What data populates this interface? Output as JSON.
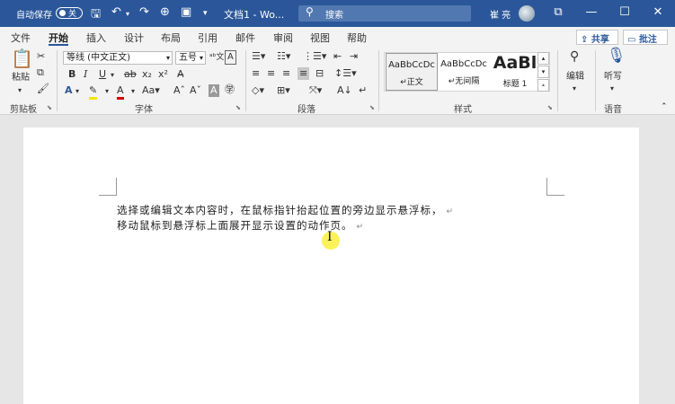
{
  "titlebar": {
    "autosave_label": "自动保存",
    "autosave_state": "关",
    "doc_title": "文档1 - Wo...",
    "search_placeholder": "搜索",
    "user_name": "崔 亮",
    "icons": [
      "save-icon",
      "undo-icon",
      "redo-icon",
      "touch-mode-icon",
      "print-preview-icon",
      "customize-qat-icon",
      "ribbon-display-icon",
      "minimize-icon",
      "maximize-icon",
      "close-icon"
    ]
  },
  "tabs": {
    "items": [
      "文件",
      "开始",
      "插入",
      "设计",
      "布局",
      "引用",
      "邮件",
      "审阅",
      "视图",
      "帮助"
    ],
    "active": "开始",
    "share": "共享",
    "comments": "批注"
  },
  "ribbon": {
    "clipboard": {
      "label": "剪贴板",
      "paste": "粘贴"
    },
    "font": {
      "label": "字体",
      "font_name": "等线 (中文正文)",
      "font_size": "五号"
    },
    "paragraph": {
      "label": "段落"
    },
    "styles": {
      "label": "样式",
      "items": [
        {
          "sample": "AaBbCcDc",
          "name": "↵正文"
        },
        {
          "sample": "AaBbCcDc",
          "name": "↵无间隔"
        },
        {
          "sample": "AaBl",
          "name": "标题 1"
        }
      ]
    },
    "editing": {
      "label": "编辑"
    },
    "voice": {
      "label": "语音",
      "dictate": "听写"
    }
  },
  "document": {
    "lines": [
      "选择或编辑文本内容时，在鼠标指针抬起位置的旁边显示悬浮标，",
      "移动鼠标到悬浮标上面展开显示设置的动作页。"
    ],
    "return_mark": "↵"
  },
  "colors": {
    "titlebar": "#2b579a",
    "ribbon": "#f3f3f3",
    "highlight": "#faf03c"
  }
}
